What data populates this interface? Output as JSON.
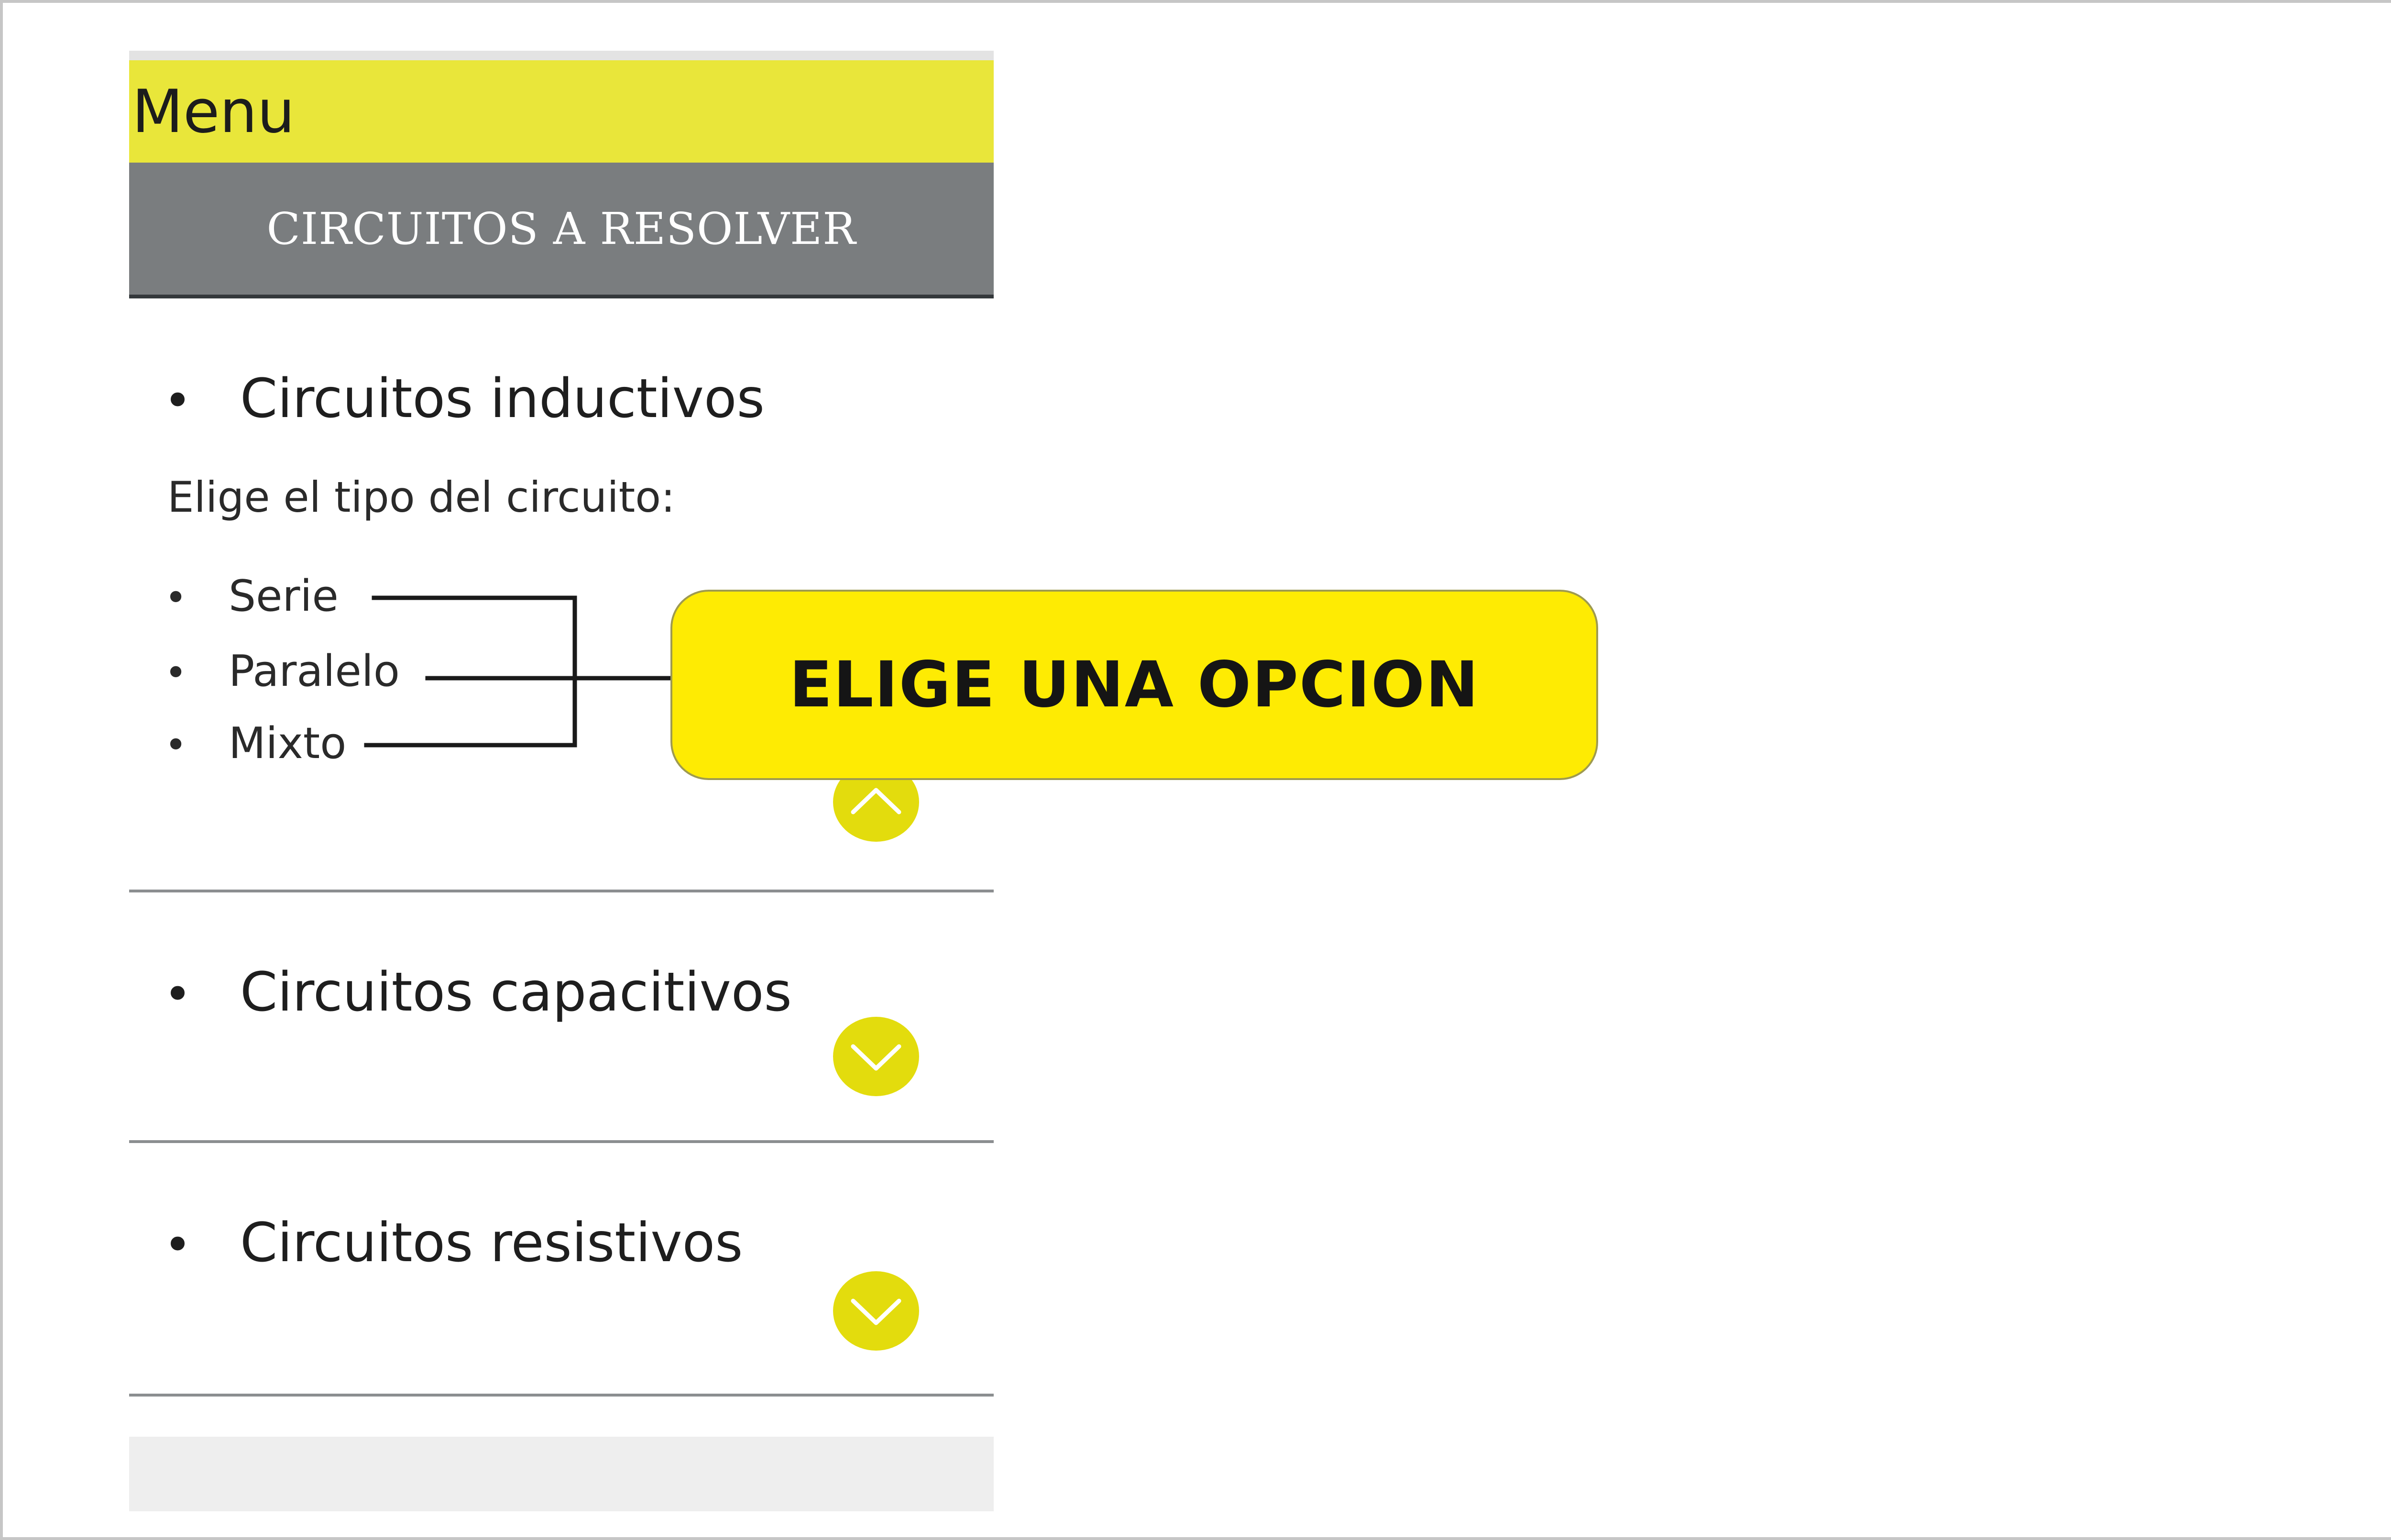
{
  "menu": {
    "title": "Menu"
  },
  "section": {
    "header": "CIRCUITOS A RESOLVER"
  },
  "accordion": {
    "items": [
      {
        "title": "Circuitos inductivos",
        "hint": "Elige el tipo del circuito:",
        "options": [
          "Serie",
          "Paralelo",
          "Mixto"
        ],
        "expanded": true,
        "toggle_icon": "chevron-up-icon"
      },
      {
        "title": "Circuitos capacitivos",
        "expanded": false,
        "toggle_icon": "chevron-down-icon"
      },
      {
        "title": "Circuitos resistivos",
        "expanded": false,
        "toggle_icon": "chevron-down-icon"
      }
    ],
    "bullet": "•"
  },
  "callout": {
    "text": "ELIGE UNA OPCION"
  },
  "colors": {
    "menu_bar": "#e9e63a",
    "section_header": "#7a7d7f",
    "chevron_button": "#e3dc0d",
    "callout": "#feeb03"
  }
}
